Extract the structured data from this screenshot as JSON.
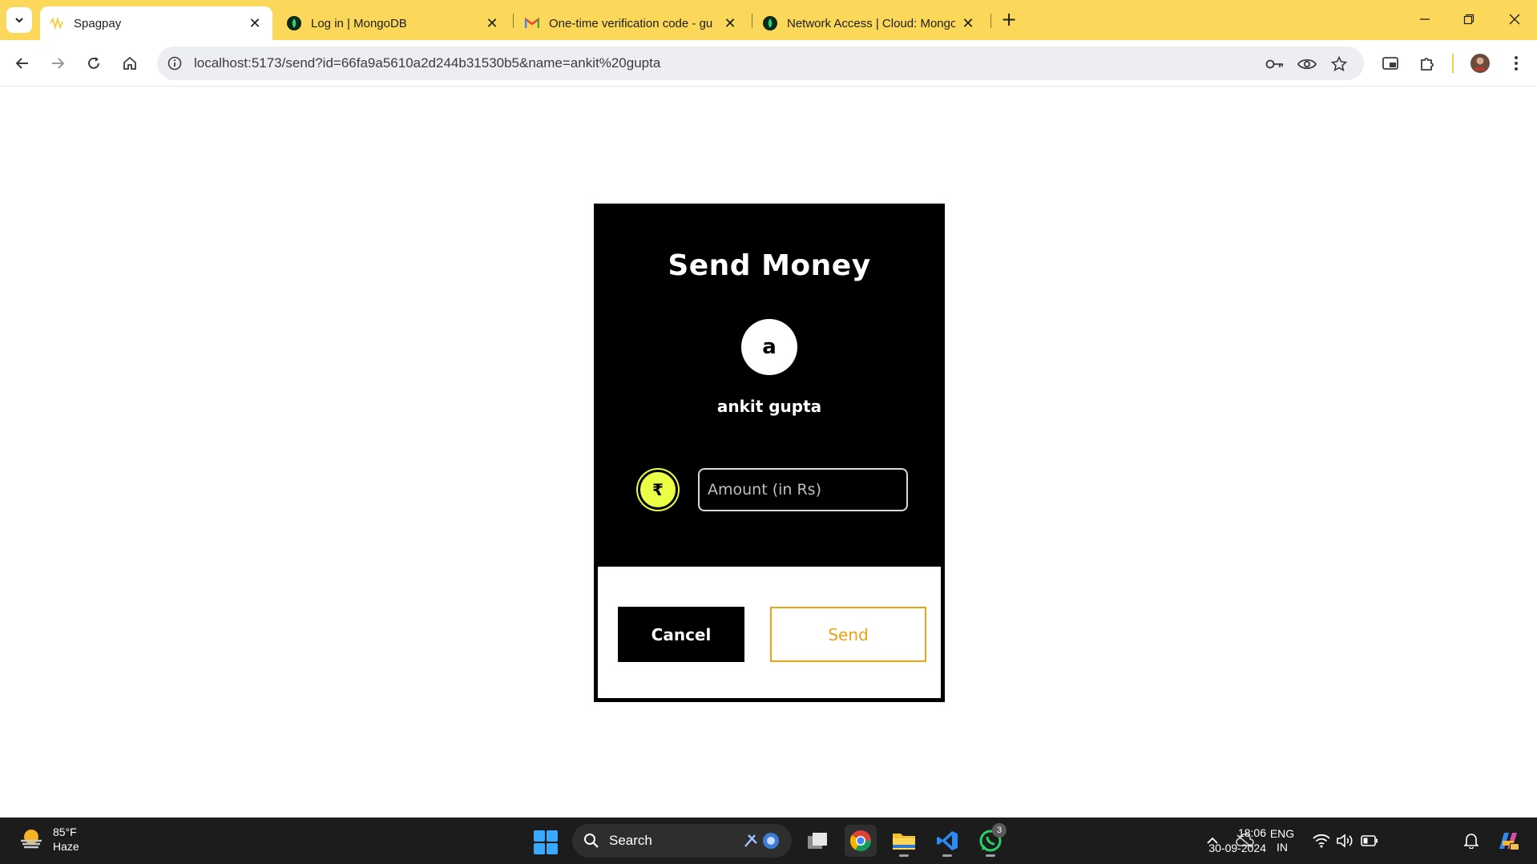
{
  "browser": {
    "tabs": [
      {
        "title": "Spagpay",
        "active": true,
        "icon": "spagpay-favicon"
      },
      {
        "title": "Log in | MongoDB",
        "active": false,
        "icon": "mongodb-leaf-icon"
      },
      {
        "title": "One-time verification code - gu",
        "active": false,
        "icon": "gmail-icon"
      },
      {
        "title": "Network Access | Cloud: Mongo",
        "active": false,
        "icon": "mongodb-leaf-icon"
      }
    ],
    "new_tab_symbol": "+",
    "address_bar": {
      "url": "localhost:5173/send?id=66fa9a5610a2d244b31530b5&name=ankit%20gupta"
    },
    "colors": {
      "tabstrip": "#fbd85a"
    }
  },
  "page": {
    "title": "Send Money",
    "avatar_letter": "a",
    "recipient_name": "ankit gupta",
    "currency_symbol": "₹",
    "amount_placeholder": "Amount (in Rs)",
    "cancel_label": "Cancel",
    "send_label": "Send",
    "colors": {
      "accent": "#ecff47",
      "send": "#e8a317",
      "card": "#000000"
    }
  },
  "taskbar": {
    "weather": {
      "temp": "85°F",
      "condition": "Haze"
    },
    "search_label": "Search",
    "whatsapp_badge": "3",
    "language": {
      "line1": "ENG",
      "line2": "IN"
    },
    "time": "18:06",
    "date": "30-09-2024"
  }
}
